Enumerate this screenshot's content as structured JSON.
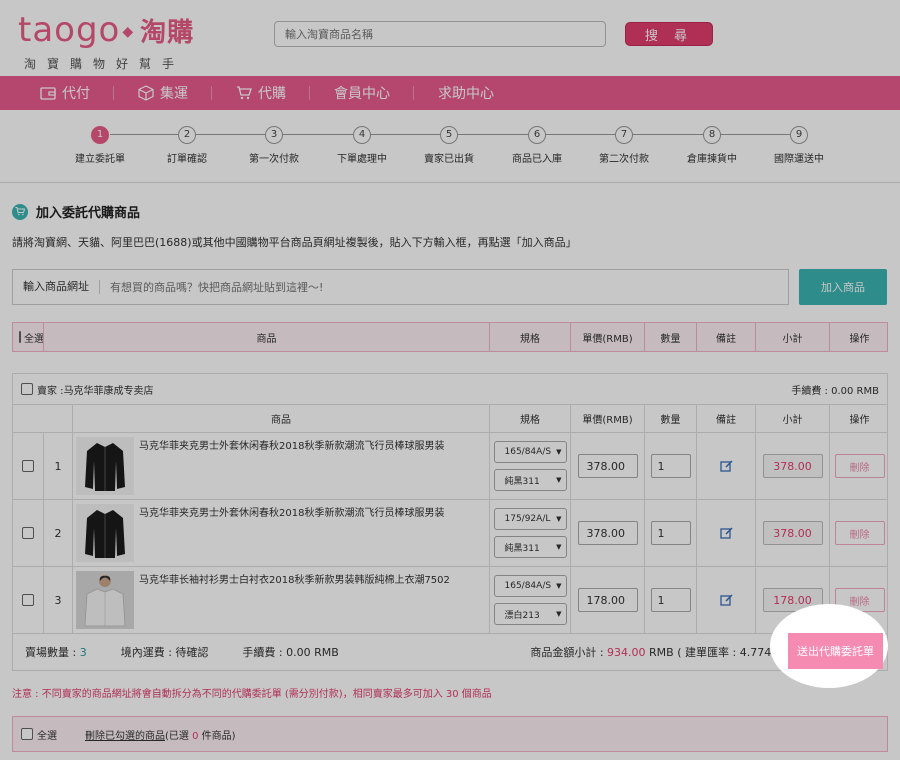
{
  "logo": {
    "en": "taogo",
    "cn": "淘購",
    "tagline": "淘寶購物好幫手"
  },
  "search": {
    "placeholder": "輸入淘寶商品名稱",
    "button": "搜 尋"
  },
  "nav": [
    {
      "label": "代付",
      "icon": "wallet-icon"
    },
    {
      "label": "集運",
      "icon": "box-icon"
    },
    {
      "label": "代購",
      "icon": "cart-icon"
    },
    {
      "label": "會員中心",
      "icon": ""
    },
    {
      "label": "求助中心",
      "icon": ""
    }
  ],
  "steps": [
    {
      "num": "1",
      "label": "建立委託單"
    },
    {
      "num": "2",
      "label": "訂單確認"
    },
    {
      "num": "3",
      "label": "第一次付款"
    },
    {
      "num": "4",
      "label": "下單處理中"
    },
    {
      "num": "5",
      "label": "賣家已出貨"
    },
    {
      "num": "6",
      "label": "商品已入庫"
    },
    {
      "num": "7",
      "label": "第二次付款"
    },
    {
      "num": "8",
      "label": "倉庫揀貨中"
    },
    {
      "num": "9",
      "label": "國際運送中"
    }
  ],
  "section": {
    "title": "加入委託代購商品",
    "instruction": "請將淘寶網、天貓、阿里巴巴(1688)或其他中國購物平台商品頁網址複製後，貼入下方輸入框，再點選「加入商品」",
    "url_label": "輸入商品網址",
    "url_placeholder": "有想買的商品嗎？快把商品網址貼到這裡～!",
    "add_button": "加入商品"
  },
  "table_headers": {
    "select_all": "全選",
    "product": "商品",
    "spec": "規格",
    "unit_price": "單價(RMB)",
    "quantity": "數量",
    "note": "備註",
    "subtotal": "小計",
    "action": "操作"
  },
  "seller": {
    "label": "賣家 :",
    "name": "马克华菲康成专卖店",
    "fee_label": "手續費 : ",
    "fee": "0.00 RMB"
  },
  "items": [
    {
      "index": "1",
      "name": "马克华菲夹克男士外套休闲春秋2018秋季新款潮流飞行员棒球服男装",
      "size": "165/84A/S",
      "color": "純黑311",
      "price": "378.00",
      "qty": "1",
      "subtotal": "378.00",
      "delete": "刪除"
    },
    {
      "index": "2",
      "name": "马克华菲夹克男士外套休闲春秋2018秋季新款潮流飞行员棒球服男装",
      "size": "175/92A/L",
      "color": "純黑311",
      "price": "378.00",
      "qty": "1",
      "subtotal": "378.00",
      "delete": "刪除"
    },
    {
      "index": "3",
      "name": "马克华菲长袖衬衫男士白衬衣2018秋季新款男装韩版純棉上衣潮7502",
      "size": "165/84A/S",
      "color": "漂白213",
      "price": "178.00",
      "qty": "1",
      "subtotal": "178.00",
      "delete": "刪除"
    }
  ],
  "summary": {
    "count_label": "賣場數量 : ",
    "count": "3",
    "domestic_label": "境內運費 : 待確認",
    "fee_label": "手續費 : 0.00 RMB",
    "total_label": "商品金額小計 : ",
    "total": "934.00",
    "total_suffix": " RMB ( 建單匯率 : 4.774 )",
    "submit": "送出代購委託單"
  },
  "note": "注意 : 不同賣家的商品網址將會自動拆分為不同的代購委託單 (需分別付款)，相同賣家最多可加入 30 個商品",
  "footer": {
    "select_all": "全選",
    "delete_selected": "刪除已勾選的商品",
    "selected_prefix": " (已選 ",
    "selected_count": "0",
    "selected_suffix": " 件商品)"
  },
  "colors": {
    "brand_pink": "#e85b8e",
    "teal": "#3cb4b2",
    "red": "#e23d6e"
  }
}
